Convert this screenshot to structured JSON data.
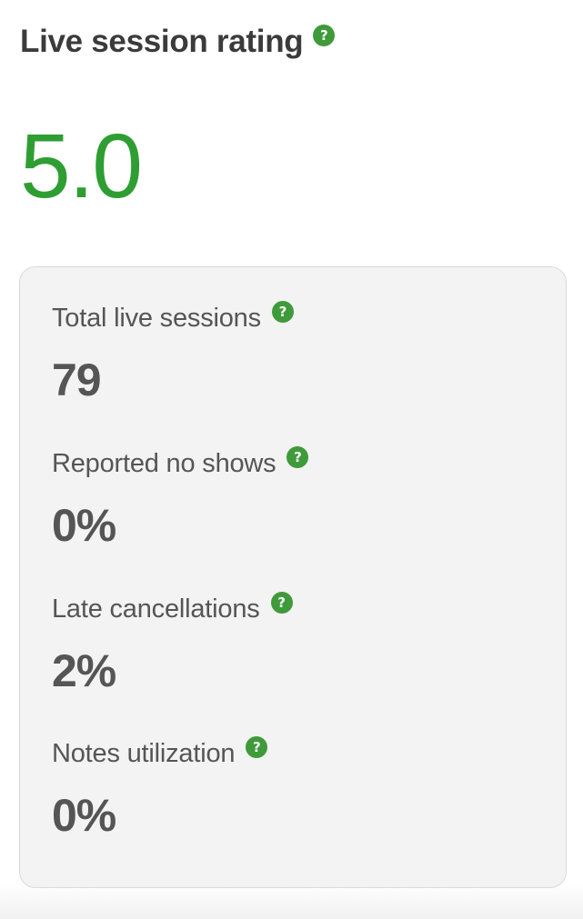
{
  "header": {
    "title": "Live session rating",
    "help_icon": "question-circle-icon",
    "help_glyph": "?"
  },
  "rating": {
    "value": "5.0"
  },
  "stats": [
    {
      "label": "Total live sessions",
      "value": "79",
      "help_glyph": "?"
    },
    {
      "label": "Reported no shows",
      "value": "0%",
      "help_glyph": "?"
    },
    {
      "label": "Late cancellations",
      "value": "2%",
      "help_glyph": "?"
    },
    {
      "label": "Notes utilization",
      "value": "0%",
      "help_glyph": "?"
    }
  ],
  "colors": {
    "accent_green": "#3f9a3a",
    "rating_green": "#2e9e33",
    "card_background": "#f3f3f3",
    "card_border": "#d9d9d9",
    "text_dark": "#3b3b3b",
    "text_muted": "#555555"
  }
}
